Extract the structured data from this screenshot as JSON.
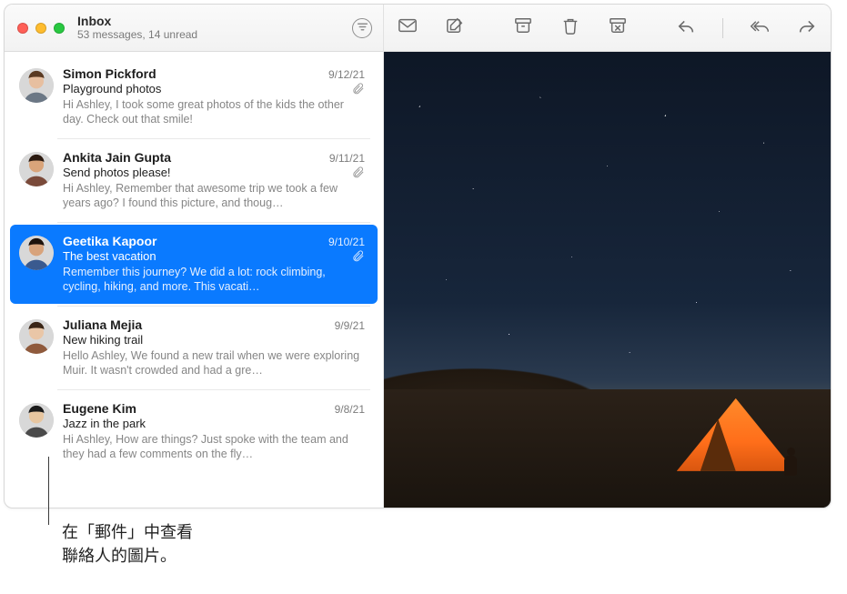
{
  "header": {
    "title": "Inbox",
    "subtitle": "53 messages, 14 unread"
  },
  "toolbar": {
    "filter": "filter",
    "mark": "mark-unread",
    "compose": "compose",
    "archive": "archive",
    "delete": "delete",
    "junk": "junk",
    "reply": "reply",
    "replyAll": "reply-all",
    "forward": "forward"
  },
  "messages": [
    {
      "sender": "Simon Pickford",
      "date": "9/12/21",
      "subject": "Playground photos",
      "attachment": true,
      "preview": "Hi Ashley, I took some great photos of the kids the other day. Check out that smile!",
      "avatar": {
        "skin": "#e7bfa0",
        "hair": "#5a3a23",
        "shirt": "#6b7785"
      },
      "selected": false
    },
    {
      "sender": "Ankita Jain Gupta",
      "date": "9/11/21",
      "subject": "Send photos please!",
      "attachment": true,
      "preview": "Hi Ashley, Remember that awesome trip we took a few years ago? I found this picture, and thoug…",
      "avatar": {
        "skin": "#d9a47a",
        "hair": "#2b1a10",
        "shirt": "#7a4a3a"
      },
      "selected": false
    },
    {
      "sender": "Geetika Kapoor",
      "date": "9/10/21",
      "subject": "The best vacation",
      "attachment": true,
      "preview": "Remember this journey? We did a lot: rock climbing, cycling, hiking, and more. This vacati…",
      "avatar": {
        "skin": "#d8a37b",
        "hair": "#1e120b",
        "shirt": "#3a5a8f"
      },
      "selected": true
    },
    {
      "sender": "Juliana Mejia",
      "date": "9/9/21",
      "subject": "New hiking trail",
      "attachment": false,
      "preview": "Hello Ashley, We found a new trail when we were exploring Muir. It wasn't crowded and had a gre…",
      "avatar": {
        "skin": "#e9c6a7",
        "hair": "#3a2516",
        "shirt": "#8f5a3c"
      },
      "selected": false
    },
    {
      "sender": "Eugene Kim",
      "date": "9/8/21",
      "subject": "Jazz in the park",
      "attachment": false,
      "preview": "Hi Ashley, How are things? Just spoke with the team and they had a few comments on the fly…",
      "avatar": {
        "skin": "#e7c6a0",
        "hair": "#1a1a1a",
        "shirt": "#4a4a4a"
      },
      "selected": false
    }
  ],
  "callout": {
    "line1": "在「郵件」中查看",
    "line2": "聯絡人的圖片。"
  }
}
